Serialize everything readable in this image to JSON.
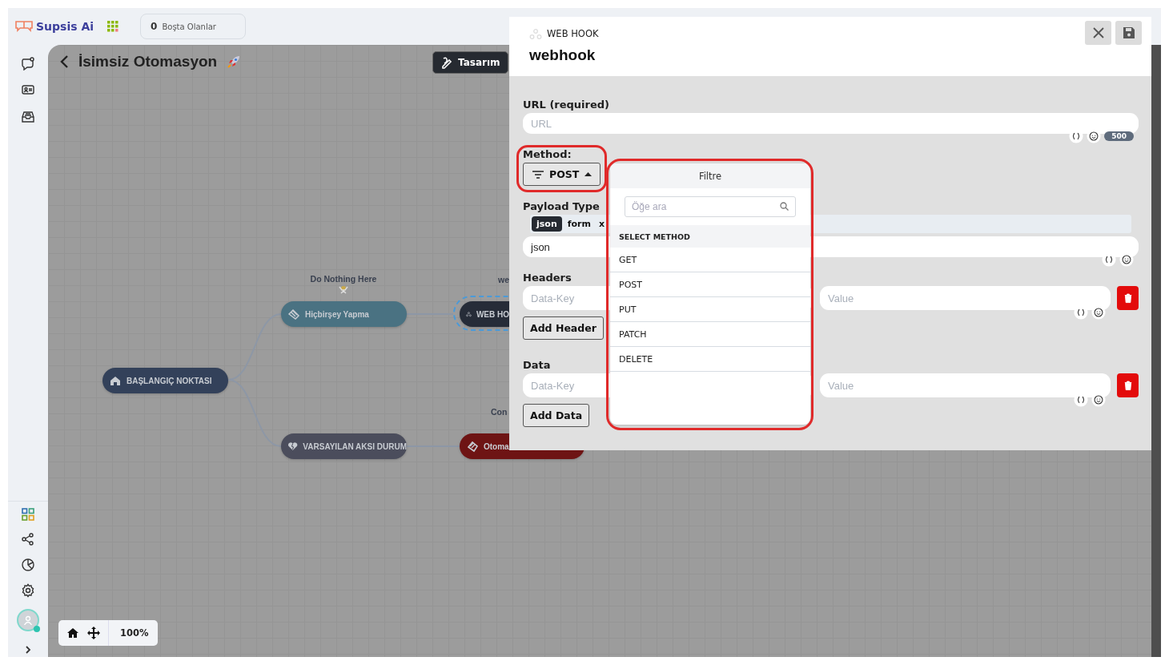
{
  "header": {
    "brand": "Supsis Ai",
    "idle_count": "0",
    "idle_label": "Boşta Olanlar"
  },
  "flow": {
    "title": "İsimsiz Otomasyon",
    "design_button": "Tasarım",
    "zoom": "100%",
    "nodes": [
      {
        "kind": "start",
        "label": "BAŞLANGIÇ NOKTASI",
        "selected": false
      },
      {
        "kind": "action",
        "label": "Hiçbirşey Yapma",
        "caption": "Do Nothing Here",
        "selected": false
      },
      {
        "kind": "webhook",
        "label": "WEB HO",
        "caption": "we",
        "selected": true
      },
      {
        "kind": "fallback",
        "label": "VARSAYILAN AKSI DURUM",
        "selected": false
      },
      {
        "kind": "error",
        "label": "Otoma",
        "caption": "Con",
        "selected": false
      }
    ]
  },
  "panel": {
    "type_label": "WEB HOOK",
    "title": "webhook",
    "url": {
      "label": "URL (required)",
      "placeholder": "URL",
      "counter": "500"
    },
    "method": {
      "label": "Method:",
      "value": "POST",
      "expanded": true
    },
    "payload": {
      "label": "Payload Type",
      "options": [
        {
          "label": "json",
          "selected": true
        },
        {
          "label": "form",
          "selected": false
        },
        {
          "label": "x",
          "selected": false
        }
      ],
      "value": "json"
    },
    "headers": {
      "label": "Headers",
      "key_placeholder": "Data-Key",
      "value_placeholder": "Value",
      "add_button": "Add Header"
    },
    "data": {
      "label": "Data",
      "key_placeholder": "Data-Key",
      "value_placeholder": "Value",
      "add_button": "Add Data"
    }
  },
  "method_menu": {
    "title": "Filtre",
    "search_placeholder": "Öğe ara",
    "section": "SELECT METHOD",
    "items": [
      "GET",
      "POST",
      "PUT",
      "PATCH",
      "DELETE"
    ]
  }
}
